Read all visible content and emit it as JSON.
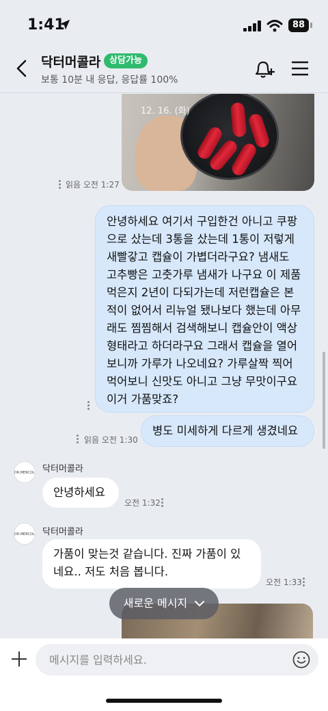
{
  "status_bar": {
    "time": "1:41",
    "battery": "88"
  },
  "header": {
    "title": "닥터머콜라",
    "status": "상담가능",
    "subtitle": "보통 10분 내 응답, 응답률 100%"
  },
  "messages": {
    "photo_date": "12. 16. (화)",
    "photo_meta": "읽음 오전 1:27",
    "me_long": "안녕하세요 여기서 구입한건 아니고 쿠팡으로 샀는데 3통을 샀는데 1통이 저렇게 새빨갛고 캡슐이 가볍더라구요? 냄새도 고추빵은 고춧가루 냄새가 나구요 이 제품 먹은지 2년이 다되가는데 저런캡슐은 본적이 없어서 리뉴얼 됐나보다 했는데 아무래도 찜찜해서 검색해보니 캡슐안이 액상형태라고 하더라구요 그래서 캡슐을 열어보니까 가루가 나오네요? 가루살짝 찍어먹어보니 신맛도 아니고 그냥 무맛이구요 이거 가품맞죠?",
    "me_short": "병도 미세하게 다르게 생겼네요",
    "me_short_meta": "읽음 오전 1:30",
    "sender_name": "닥터머콜라",
    "avatar_text": "DR.MERCOLA",
    "them_1": "안녕하세요",
    "them_1_meta": "오전 1:32",
    "them_2": "가품이 맞는것 같습니다. 진짜 가품이 있네요.. 저도 처음 봅니다.",
    "them_2_meta": "오전 1:33"
  },
  "new_message_button": "새로운 메시지",
  "input": {
    "placeholder": "메시지를 입력하세요."
  }
}
